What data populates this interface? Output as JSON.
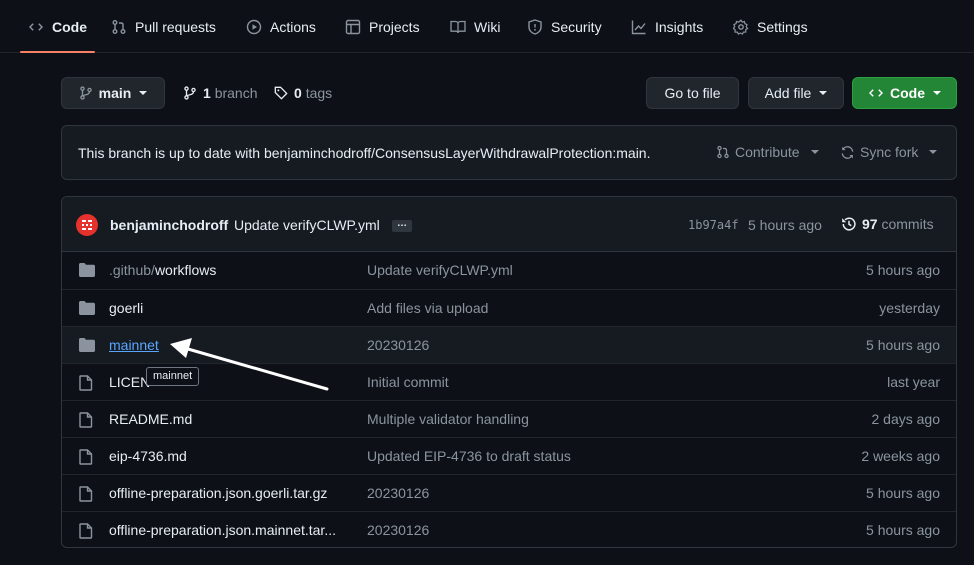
{
  "nav": {
    "tabs": [
      {
        "label": "Code",
        "icon": "code-icon",
        "active": true
      },
      {
        "label": "Pull requests",
        "icon": "pull-request-icon"
      },
      {
        "label": "Actions",
        "icon": "play-icon"
      },
      {
        "label": "Projects",
        "icon": "table-icon"
      },
      {
        "label": "Wiki",
        "icon": "book-icon"
      },
      {
        "label": "Security",
        "icon": "shield-icon"
      },
      {
        "label": "Insights",
        "icon": "graph-icon"
      },
      {
        "label": "Settings",
        "icon": "gear-icon"
      }
    ]
  },
  "toolbar": {
    "branch": "main",
    "branches_count": "1",
    "branches_label": "branch",
    "tags_count": "0",
    "tags_label": "tags",
    "go_to_file": "Go to file",
    "add_file": "Add file",
    "code": "Code"
  },
  "banner": {
    "text": "This branch is up to date with benjaminchodroff/ConsensusLayerWithdrawalProtection:main.",
    "contribute": "Contribute",
    "sync_fork": "Sync fork"
  },
  "commit": {
    "author": "benjaminchodroff",
    "message": "Update verifyCLWP.yml",
    "ellipsis": "…",
    "sha": "1b97a4f",
    "time": "5 hours ago",
    "commits_count": "97",
    "commits_label": "commits"
  },
  "files": [
    {
      "dir_prefix": ".github/",
      "name": "workflows",
      "type": "dir",
      "message": "Update verifyCLWP.yml",
      "time": "5 hours ago"
    },
    {
      "dir_prefix": "",
      "name": "goerli",
      "type": "dir",
      "message": "Add files via upload",
      "time": "yesterday"
    },
    {
      "dir_prefix": "",
      "name": "mainnet",
      "type": "dir",
      "message": "20230126",
      "time": "5 hours ago"
    },
    {
      "dir_prefix": "",
      "name": "LICEN",
      "type": "file",
      "message": "Initial commit",
      "time": "last year"
    },
    {
      "dir_prefix": "",
      "name": "README.md",
      "type": "file",
      "message": "Multiple validator handling",
      "time": "2 days ago"
    },
    {
      "dir_prefix": "",
      "name": "eip-4736.md",
      "type": "file",
      "message": "Updated EIP-4736 to draft status",
      "time": "2 weeks ago"
    },
    {
      "dir_prefix": "",
      "name": "offline-preparation.json.goerli.tar.gz",
      "type": "file",
      "message": "20230126",
      "time": "5 hours ago"
    },
    {
      "dir_prefix": "",
      "name": "offline-preparation.json.mainnet.tar...",
      "type": "file",
      "message": "20230126",
      "time": "5 hours ago"
    }
  ],
  "tooltip": "mainnet",
  "colors": {
    "background": "#0d1117",
    "accent_green": "#238636",
    "link_blue": "#58a6ff",
    "tab_underline": "#f78166",
    "avatar_red": "#e5322d"
  }
}
